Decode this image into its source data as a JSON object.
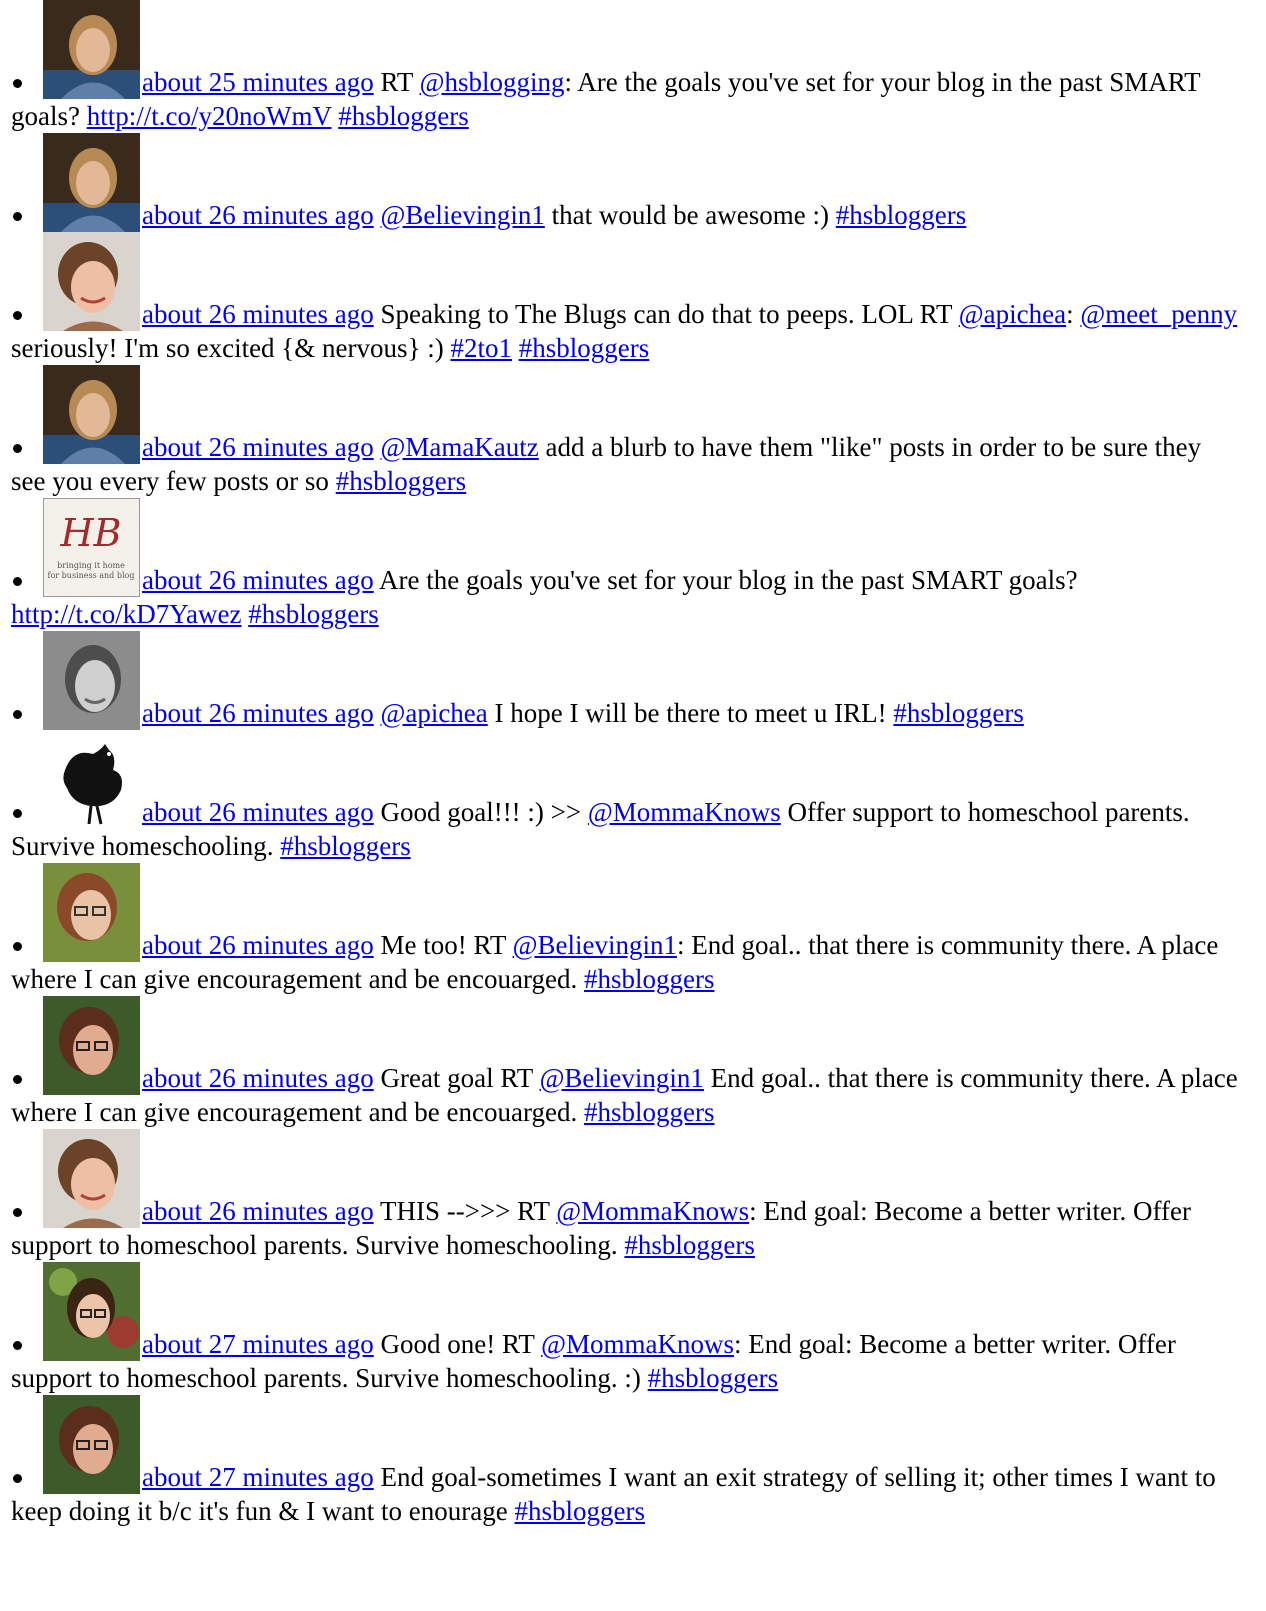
{
  "tweets": [
    {
      "avatar_icon": "user-avatar-icon-blonde-woman",
      "time": "about 25 minutes ago",
      "parts": [
        {
          "t": "text",
          "v": " RT "
        },
        {
          "t": "link",
          "v": "@hsblogging"
        },
        {
          "t": "text",
          "v": ": Are the goals you've set for your blog in the past SMART goals? "
        },
        {
          "t": "link",
          "v": "http://t.co/y20noWmV"
        },
        {
          "t": "text",
          "v": " "
        },
        {
          "t": "link",
          "v": "#hsbloggers"
        }
      ]
    },
    {
      "avatar_icon": "user-avatar-icon-blonde-woman",
      "time": "about 26 minutes ago",
      "parts": [
        {
          "t": "text",
          "v": " "
        },
        {
          "t": "link",
          "v": "@Believingin1"
        },
        {
          "t": "text",
          "v": " that would be awesome :) "
        },
        {
          "t": "link",
          "v": "#hsbloggers"
        }
      ]
    },
    {
      "avatar_icon": "user-avatar-icon-smiling-woman",
      "time": "about 26 minutes ago",
      "parts": [
        {
          "t": "text",
          "v": " Speaking to The Blugs can do that to peeps. LOL RT "
        },
        {
          "t": "link",
          "v": "@apichea"
        },
        {
          "t": "text",
          "v": ": "
        },
        {
          "t": "link",
          "v": "@meet_penny"
        },
        {
          "t": "text",
          "v": " seriously! I'm so excited {& nervous} :) "
        },
        {
          "t": "link",
          "v": "#2to1"
        },
        {
          "t": "text",
          "v": " "
        },
        {
          "t": "link",
          "v": "#hsbloggers"
        }
      ]
    },
    {
      "avatar_icon": "user-avatar-icon-blonde-woman",
      "time": "about 26 minutes ago",
      "parts": [
        {
          "t": "text",
          "v": " "
        },
        {
          "t": "link",
          "v": "@MamaKautz"
        },
        {
          "t": "text",
          "v": " add a blurb to have them \"like\" posts in order to be sure they see you every few posts or so "
        },
        {
          "t": "link",
          "v": "#hsbloggers"
        }
      ]
    },
    {
      "avatar_icon": "hb-logo-icon",
      "time": "about 26 minutes ago",
      "parts": [
        {
          "t": "text",
          "v": " Are the goals you've set for your blog in the past SMART goals? "
        },
        {
          "t": "link",
          "v": "http://t.co/kD7Yawez"
        },
        {
          "t": "text",
          "v": " "
        },
        {
          "t": "link",
          "v": "#hsbloggers"
        }
      ]
    },
    {
      "avatar_icon": "user-avatar-icon-grayscale-woman",
      "time": "about 26 minutes ago",
      "parts": [
        {
          "t": "text",
          "v": " "
        },
        {
          "t": "link",
          "v": "@apichea"
        },
        {
          "t": "text",
          "v": " I hope I will be there to meet u IRL! "
        },
        {
          "t": "link",
          "v": "#hsbloggers"
        }
      ]
    },
    {
      "avatar_icon": "hen-silhouette-icon",
      "time": "about 26 minutes ago",
      "parts": [
        {
          "t": "text",
          "v": " Good goal!!! :) >> "
        },
        {
          "t": "link",
          "v": "@MommaKnows"
        },
        {
          "t": "text",
          "v": " Offer support to homeschool parents. Survive homeschooling. "
        },
        {
          "t": "link",
          "v": "#hsbloggers"
        }
      ]
    },
    {
      "avatar_icon": "user-avatar-icon-woman-glasses",
      "time": "about 26 minutes ago",
      "parts": [
        {
          "t": "text",
          "v": " Me too! RT "
        },
        {
          "t": "link",
          "v": "@Believingin1"
        },
        {
          "t": "text",
          "v": ": End goal.. that there is community there. A place where I can give encouragement and be encouarged. "
        },
        {
          "t": "link",
          "v": "#hsbloggers"
        }
      ]
    },
    {
      "avatar_icon": "user-avatar-icon-woman-glasses-brown",
      "time": "about 26 minutes ago",
      "parts": [
        {
          "t": "text",
          "v": " Great goal RT "
        },
        {
          "t": "link",
          "v": "@Believingin1"
        },
        {
          "t": "text",
          "v": " End goal.. that there is community there. A place where I can give encouragement and be encouarged. "
        },
        {
          "t": "link",
          "v": "#hsbloggers"
        }
      ]
    },
    {
      "avatar_icon": "user-avatar-icon-smiling-woman",
      "time": "about 26 minutes ago",
      "parts": [
        {
          "t": "text",
          "v": " THIS -->>> RT "
        },
        {
          "t": "link",
          "v": "@MommaKnows"
        },
        {
          "t": "text",
          "v": ": End goal: Become a better writer. Offer support to homeschool parents. Survive homeschooling. "
        },
        {
          "t": "link",
          "v": "#hsbloggers"
        }
      ]
    },
    {
      "avatar_icon": "user-avatar-icon-woman-garden",
      "time": "about 27 minutes ago",
      "parts": [
        {
          "t": "text",
          "v": " Good one! RT "
        },
        {
          "t": "link",
          "v": "@MommaKnows"
        },
        {
          "t": "text",
          "v": ": End goal: Become a better writer. Offer support to homeschool parents. Survive homeschooling. :) "
        },
        {
          "t": "link",
          "v": "#hsbloggers"
        }
      ]
    },
    {
      "avatar_icon": "user-avatar-icon-woman-glasses-brown",
      "time": "about 27 minutes ago",
      "parts": [
        {
          "t": "text",
          "v": " End goal-sometimes I want an exit strategy of selling it; other times I want to keep doing it b/c it's fun & I want to enourage "
        },
        {
          "t": "link",
          "v": "#hsbloggers"
        }
      ]
    }
  ]
}
